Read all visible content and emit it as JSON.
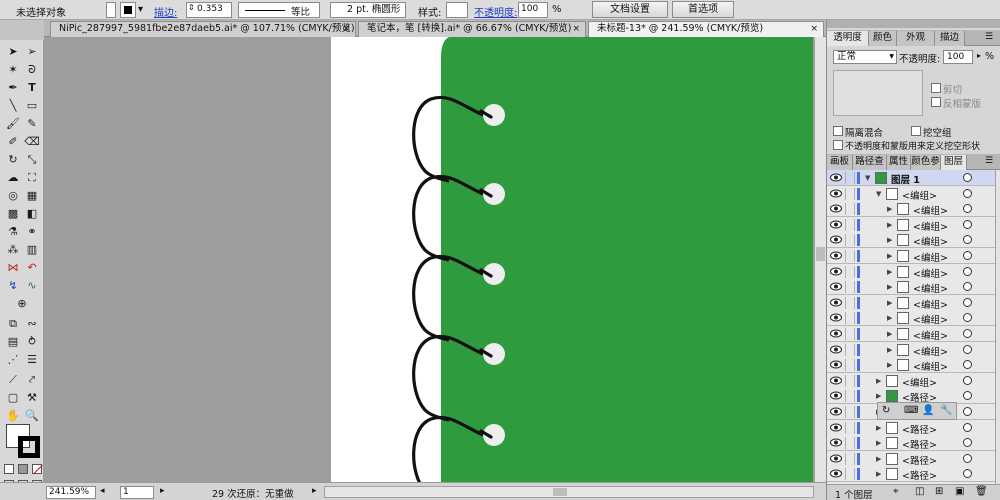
{
  "control_bar": {
    "selection_label": "未选择对象",
    "stroke_label": "描边:",
    "stroke_value": "0.353",
    "profile_label": "等比",
    "brush_label": "2 pt. 椭圆形",
    "style_label": "样式:",
    "opacity_label": "不透明度:",
    "opacity_value": "100",
    "percent": "%",
    "doc_setup": "文档设置",
    "preferences": "首选项"
  },
  "tabs": [
    {
      "label": "NiPic_287997_5981fbe2e87daeb5.ai* @ 107.71% (CMYK/预览)",
      "active": false
    },
    {
      "label": "笔记本，笔 [转换].ai* @ 66.67% (CMYK/预览)",
      "active": false
    },
    {
      "label": "未标题-13* @ 241.59% (CMYK/预览)",
      "active": true
    }
  ],
  "status": {
    "zoom": "241.59%",
    "page": "1",
    "undo_info": "29 次还原：无重做"
  },
  "transparency_panel": {
    "tabs": [
      "透明度",
      "颜色",
      "外观",
      "描边"
    ],
    "blend_mode": "正常",
    "opacity_label": "不透明度:",
    "opacity_value": "100",
    "percent": "%",
    "clip_label": "剪切",
    "invert_label": "反相蒙版",
    "isolate_label": "隔离混合",
    "knockout_label": "挖空组",
    "opacity_mask_label": "不透明度和蒙版用来定义挖空形状"
  },
  "layers_panel": {
    "tabs": [
      "画板",
      "路径查",
      "属性",
      "颜色参",
      "图层"
    ],
    "rows": [
      {
        "name": "图层 1",
        "indent": 0,
        "selected": true,
        "thumb": "green"
      },
      {
        "name": "<编组>",
        "indent": 1,
        "selected": false,
        "thumb": "white"
      },
      {
        "name": "<编组>",
        "indent": 2,
        "selected": false,
        "thumb": "white"
      },
      {
        "name": "<编组>",
        "indent": 2,
        "selected": false,
        "thumb": "white"
      },
      {
        "name": "<编组>",
        "indent": 2,
        "selected": false,
        "thumb": "white"
      },
      {
        "name": "<编组>",
        "indent": 2,
        "selected": false,
        "thumb": "white"
      },
      {
        "name": "<编组>",
        "indent": 2,
        "selected": false,
        "thumb": "white"
      },
      {
        "name": "<编组>",
        "indent": 2,
        "selected": false,
        "thumb": "white"
      },
      {
        "name": "<编组>",
        "indent": 2,
        "selected": false,
        "thumb": "white"
      },
      {
        "name": "<编组>",
        "indent": 2,
        "selected": false,
        "thumb": "white"
      },
      {
        "name": "<编组>",
        "indent": 2,
        "selected": false,
        "thumb": "white"
      },
      {
        "name": "<编组>",
        "indent": 2,
        "selected": false,
        "thumb": "white"
      },
      {
        "name": "<编组>",
        "indent": 2,
        "selected": false,
        "thumb": "white"
      },
      {
        "name": "<编组>",
        "indent": 1,
        "selected": false,
        "thumb": "white"
      },
      {
        "name": "<路径>",
        "indent": 1,
        "selected": false,
        "thumb": "green"
      },
      {
        "name": "<路径>",
        "indent": 1,
        "selected": false,
        "thumb": "white"
      },
      {
        "name": "<路径>",
        "indent": 1,
        "selected": false,
        "thumb": "white"
      },
      {
        "name": "<路径>",
        "indent": 1,
        "selected": false,
        "thumb": "white"
      },
      {
        "name": "<路径>",
        "indent": 1,
        "selected": false,
        "thumb": "white"
      },
      {
        "name": "<路径>",
        "indent": 1,
        "selected": false,
        "thumb": "white"
      }
    ],
    "footer": "1 个图层"
  },
  "colors": {
    "artboard_green": "#2e9b3e",
    "coil": "#111111",
    "hole": "#eeeeee"
  }
}
